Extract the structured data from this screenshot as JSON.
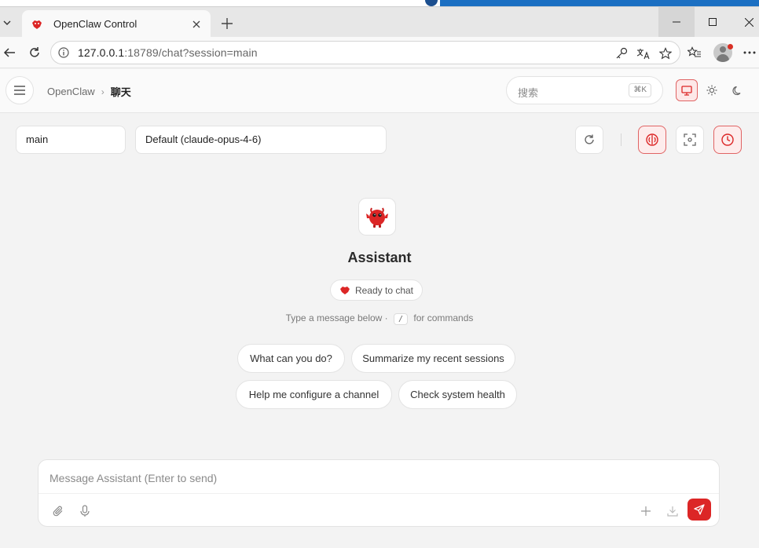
{
  "browser": {
    "tab_title": "OpenClaw Control",
    "url_host": "127.0.0.1",
    "url_rest": ":18789/chat?session=main"
  },
  "header": {
    "breadcrumb_root": "OpenClaw",
    "breadcrumb_sep": "›",
    "breadcrumb_current": "聊天",
    "search_placeholder": "搜索",
    "search_shortcut": "⌘K"
  },
  "toolbar": {
    "session": "main",
    "model": "Default (claude-opus-4-6)"
  },
  "empty_state": {
    "assistant_name": "Assistant",
    "status": "Ready to chat",
    "hint_before": "Type a message below · ",
    "hint_key": "/",
    "hint_after": " for commands",
    "suggestions": [
      "What can you do?",
      "Summarize my recent sessions",
      "Help me configure a channel",
      "Check system health"
    ]
  },
  "composer": {
    "placeholder": "Message Assistant (Enter to send)"
  },
  "colors": {
    "accent": "#dc2626",
    "accent_soft": "#fdecec"
  }
}
